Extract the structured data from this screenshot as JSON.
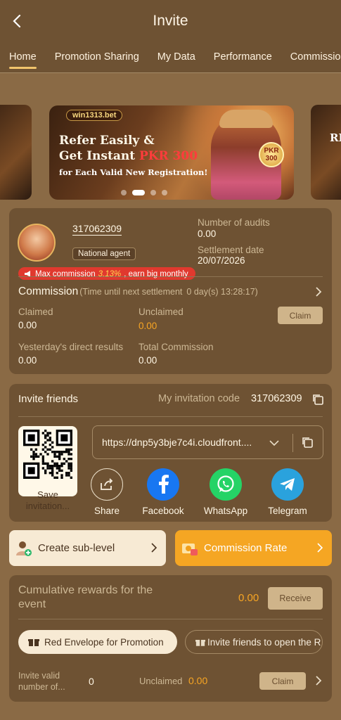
{
  "header": {
    "title": "Invite"
  },
  "tabs": [
    {
      "label": "Home"
    },
    {
      "label": "Promotion Sharing"
    },
    {
      "label": "My Data"
    },
    {
      "label": "Performance"
    },
    {
      "label": "Commission"
    }
  ],
  "banner": {
    "brand": "win1313.bet",
    "line1": "Refer Easily &",
    "line2_prefix": "Get Instant ",
    "line2_amount": "PKR 300",
    "line3": "for Each Valid New Registration!",
    "badge_top": "PKR",
    "badge_value": "300",
    "side_text": "RE",
    "active_slide": 2,
    "slide_count": 4
  },
  "agent": {
    "user_id": "317062309",
    "badge": "National agent",
    "audits_label": "Number of audits",
    "audits_value": "0.00",
    "settlement_label": "Settlement date",
    "settlement_value": "20/07/2026",
    "promo_prefix": "Max commission ",
    "promo_highlight": "3.13%",
    "promo_suffix": ", earn big monthly",
    "commission_title": "Commission",
    "commission_sub": "(Time until next settlement",
    "commission_time": "0 day(s) 13:28:17)",
    "claimed_label": "Claimed",
    "claimed_value": "0.00",
    "unclaimed_label": "Unclaimed",
    "unclaimed_value": "0.00",
    "claim_label": "Claim",
    "yesterday_label": "Yesterday's direct results",
    "yesterday_value": "0.00",
    "total_label": "Total Commission",
    "total_value": "0.00"
  },
  "invite": {
    "title": "Invite friends",
    "code_label": "My invitation code",
    "code": "317062309",
    "qr_label_1": "Save",
    "qr_label_2": "invitation...",
    "link": "https://dnp5y3bje7c4i.cloudfront....",
    "share": [
      {
        "label": "Share",
        "icon": "share-icon"
      },
      {
        "label": "Facebook",
        "icon": "facebook-icon"
      },
      {
        "label": "WhatsApp",
        "icon": "whatsapp-icon"
      },
      {
        "label": "Telegram",
        "icon": "telegram-icon"
      }
    ]
  },
  "actions": {
    "sub_level": "Create sub-level",
    "commission_rate": "Commission Rate"
  },
  "rewards": {
    "title": "Cumulative rewards for the event",
    "value": "0.00",
    "receive": "Receive",
    "pill_active": "Red Envelope for Promotion",
    "pill_other": "Invite friends to open the R",
    "valid_label": "Invite valid number of...",
    "valid_value": "0",
    "unclaimed_label": "Unclaimed",
    "unclaimed_value": "0.00",
    "claim": "Claim"
  },
  "colors": {
    "background": "#8a6a45",
    "card": "#6e5233",
    "accent": "#f5a623",
    "promo_red": "#e0392e"
  }
}
